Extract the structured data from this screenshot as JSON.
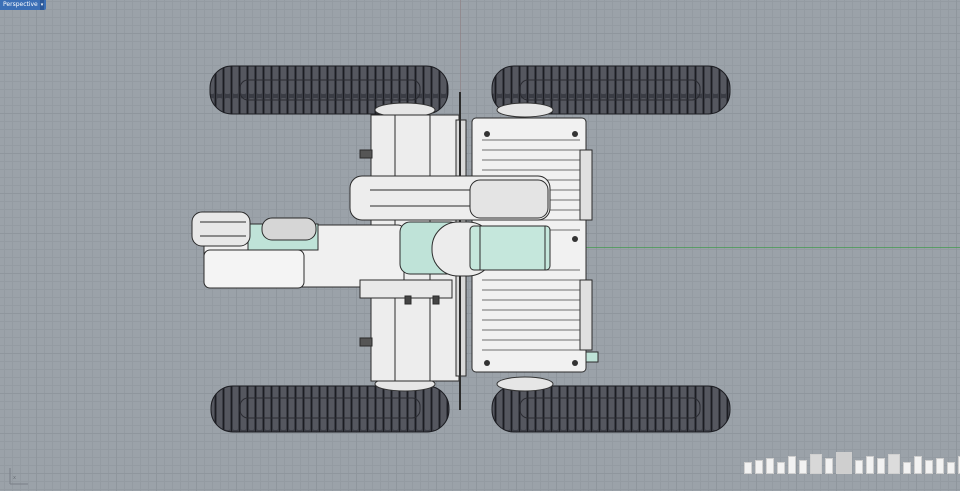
{
  "viewport": {
    "label": "Perspective",
    "dropdown_glyph": "▾",
    "axes_label": "x"
  },
  "icons": {
    "dropdown": "chevron-down-icon",
    "axes": "world-axes-icon"
  },
  "colors": {
    "background": "#9ba2a9",
    "grid_minor": "#949ba2",
    "grid_major": "#8f969d",
    "x_axis": "#3f9a4a",
    "viewport_tab": "#3b6fb6",
    "track": "#3d3f47",
    "body": "#eeeeee",
    "accent": "#bfe3d8"
  }
}
